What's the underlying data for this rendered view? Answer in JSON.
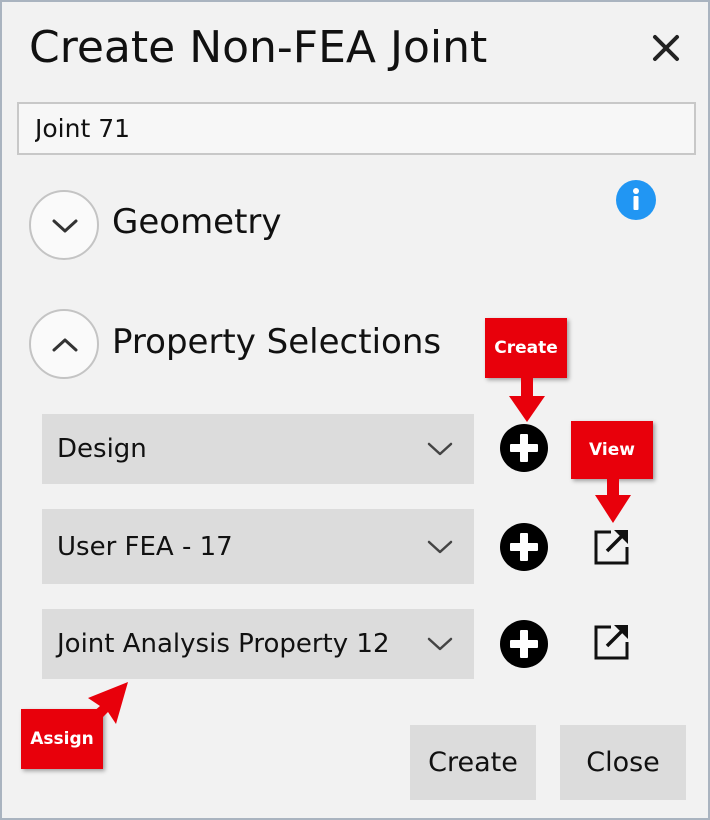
{
  "dialog": {
    "title": "Create Non-FEA Joint",
    "close_icon": "close-x-icon",
    "name_value": "Joint 71",
    "info_icon": "info-icon"
  },
  "sections": {
    "geometry": {
      "label": "Geometry",
      "state": "collapsed"
    },
    "property_selections": {
      "label": "Property Selections",
      "state": "expanded"
    }
  },
  "properties": [
    {
      "value": "Design"
    },
    {
      "value": "User FEA - 17"
    },
    {
      "value": "Joint Analysis Property 12"
    }
  ],
  "buttons": {
    "create": "Create",
    "close": "Close"
  },
  "annotations": {
    "create": "Create",
    "view": "View",
    "assign": "Assign"
  },
  "colors": {
    "dialog_bg": "#f2f2f2",
    "accent_info": "#2196f3",
    "annotation_red": "#e8000b"
  }
}
